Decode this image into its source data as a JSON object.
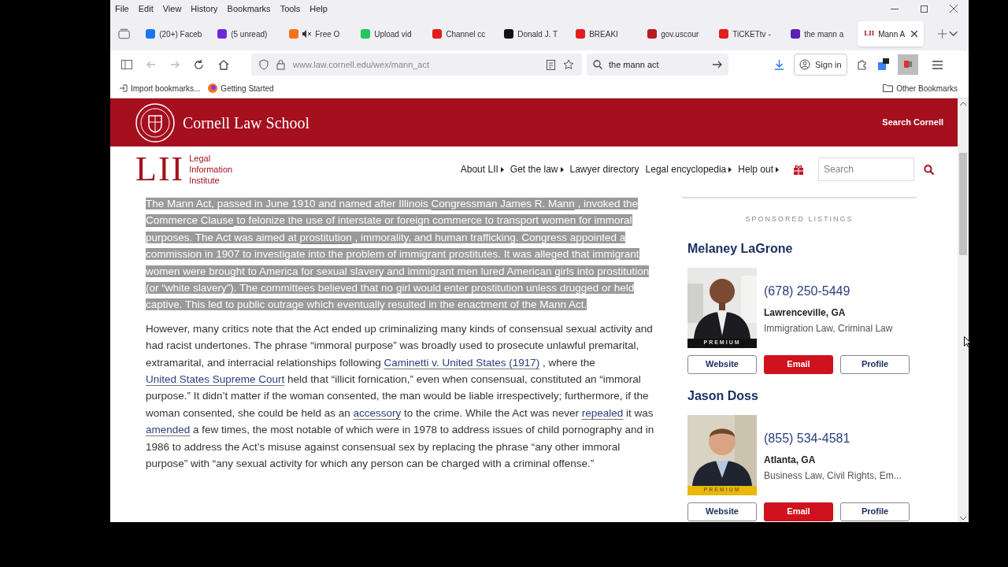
{
  "menu": [
    "File",
    "Edit",
    "View",
    "History",
    "Bookmarks",
    "Tools",
    "Help"
  ],
  "tabs": [
    {
      "label": "(20+) Faceb",
      "color": "#1877f2",
      "selected": false,
      "muted": false
    },
    {
      "label": "(5 unread)",
      "color": "#6d28d9",
      "selected": false,
      "muted": false
    },
    {
      "label": "Free O",
      "color": "#f97316",
      "selected": false,
      "muted": true
    },
    {
      "label": "Upload vid",
      "color": "#22c55e",
      "selected": false,
      "muted": false
    },
    {
      "label": "Channel cc",
      "color": "#e11d1d",
      "selected": false,
      "muted": false
    },
    {
      "label": "Donald J. T",
      "color": "#111111",
      "selected": false,
      "muted": false
    },
    {
      "label": "BREAKI",
      "color": "#e11d1d",
      "selected": false,
      "muted": false
    },
    {
      "label": "gov.uscour",
      "color": "#b91c1c",
      "selected": false,
      "muted": false
    },
    {
      "label": "TiCKETtv -",
      "color": "#e11d1d",
      "selected": false,
      "muted": false
    },
    {
      "label": "the mann a",
      "color": "#5b21b6",
      "selected": false,
      "muted": false
    },
    {
      "label": "Mann A",
      "color": "#a50f1e",
      "favicon_text": "LII",
      "selected": true,
      "muted": false
    }
  ],
  "address": {
    "host": "www.law.cornell.edu",
    "path": "/wex/mann_act"
  },
  "search": {
    "value": "the mann act"
  },
  "sign_in": "Sign in",
  "bookmarks": [
    "Import bookmarks...",
    "Getting Started"
  ],
  "other_bookmarks": "Other Bookmarks",
  "site": {
    "name": "Cornell Law School",
    "search_link": "Search Cornell",
    "lii_mark": "LII",
    "lii_name": [
      "Legal",
      "Information",
      "Institute"
    ],
    "nav": [
      {
        "label": "About LII",
        "caret": true
      },
      {
        "label": "Get the law",
        "caret": true
      },
      {
        "label": "Lawyer directory",
        "caret": false
      },
      {
        "label": "Legal encyclopedia",
        "caret": true
      },
      {
        "label": "Help out",
        "caret": true
      }
    ],
    "search_placeholder": "Search"
  },
  "paragraphs": [
    {
      "selected": true,
      "parts": [
        {
          "text": "The Mann Act, passed in June 1910 and named after Illinois ",
          "kind": "text"
        },
        {
          "text": "Congressman James R. Mann",
          "kind": "link"
        },
        {
          "text": " , invoked the ",
          "kind": "text"
        },
        {
          "text": "Commerce Clause",
          "kind": "link"
        },
        {
          "text": " to felonize the use of interstate or foreign commerce to transport women for immoral purposes. The Act was aimed at ",
          "kind": "text"
        },
        {
          "text": "prostitution",
          "kind": "link"
        },
        {
          "text": " , immorality, and human trafficking. Congress appointed a commission in 1907 to investigate into the problem of immigrant prostitutes.  It was alleged that immigrant women were brought to America for sexual slavery and immigrant men lured American girls into prostitution (or “white slavery”). The committees believed that no girl would enter prostitution unless drugged or held captive. This led to public outrage which eventually resulted in the enactment of the Mann Act.",
          "kind": "text"
        }
      ]
    },
    {
      "selected": false,
      "parts": [
        {
          "text": "However, many critics note that the Act ended up criminalizing many kinds of consensual sexual activity and had racist undertones. The phrase “immoral purpose” was broadly used to prosecute unlawful premarital, extramarital, and interracial relationships following ",
          "kind": "text"
        },
        {
          "text": "Caminetti v. United States (1917)",
          "kind": "link"
        },
        {
          "text": " , where the ",
          "kind": "text"
        },
        {
          "text": "United States Supreme Court",
          "kind": "link"
        },
        {
          "text": " held that “illicit fornication,” even when consensual, constituted an “immoral purpose.” It didn’t matter if the woman consented, the man would be liable irrespectively; furthermore, if the woman consented, she could be held as an ",
          "kind": "text"
        },
        {
          "text": "accessory",
          "kind": "link"
        },
        {
          "text": " to the crime.  While the Act was never ",
          "kind": "text"
        },
        {
          "text": "repealed",
          "kind": "link"
        },
        {
          "text": " it was ",
          "kind": "text"
        },
        {
          "text": "amended",
          "kind": "link"
        },
        {
          "text": " a few times, the most notable of which were in 1978 to address issues of child pornography and in 1986 to address the Act’s misuse against consensual sex by replacing the phrase “any other immoral purpose” with “any sexual activity for which any person can be charged with a criminal offense.”",
          "kind": "text"
        }
      ]
    }
  ],
  "sponsored": {
    "heading": "SPONSORED LISTINGS",
    "listings": [
      {
        "name": "Melaney LaGrone",
        "badge": "PREMIUM",
        "color": "#111111",
        "phone": "(678) 250-5449",
        "location": "Lawrenceville, GA",
        "practice": "Immigration Law, Criminal Law",
        "buttons": [
          {
            "label": "Website",
            "primary": false
          },
          {
            "label": "Email",
            "primary": true
          },
          {
            "label": "Profile",
            "primary": false
          }
        ]
      },
      {
        "name": "Jason Doss",
        "badge": "PREMIUM",
        "color": "#e8b90c",
        "phone": "(855) 534-4581",
        "location": "Atlanta, GA",
        "practice": "Business Law, Civil Rights, Em...",
        "buttons": [
          {
            "label": "Website",
            "primary": false
          },
          {
            "label": "Email",
            "primary": true
          },
          {
            "label": "Profile",
            "primary": false
          }
        ]
      }
    ]
  }
}
